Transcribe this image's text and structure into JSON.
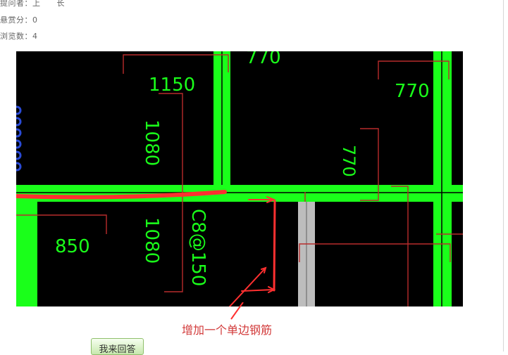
{
  "question_meta": {
    "asker_label": "提问者：",
    "asker_value": "上　　长",
    "bounty_label": "悬赏分：",
    "bounty_value": "0",
    "views_label": "浏览数：",
    "views_value": "4"
  },
  "drawing": {
    "dimensions": [
      "770",
      "770",
      "1150",
      "1080",
      "770",
      "1080",
      "850",
      "C8@150"
    ],
    "colors": {
      "background": "#000000",
      "beam": "#1aff1a",
      "leader": "#b82c2c",
      "markup": "#ff3030",
      "gray_bar": "#bdbdbd"
    }
  },
  "annotation": {
    "text": "增加一个单边钢筋"
  },
  "actions": {
    "answer_button": "我来回答"
  }
}
